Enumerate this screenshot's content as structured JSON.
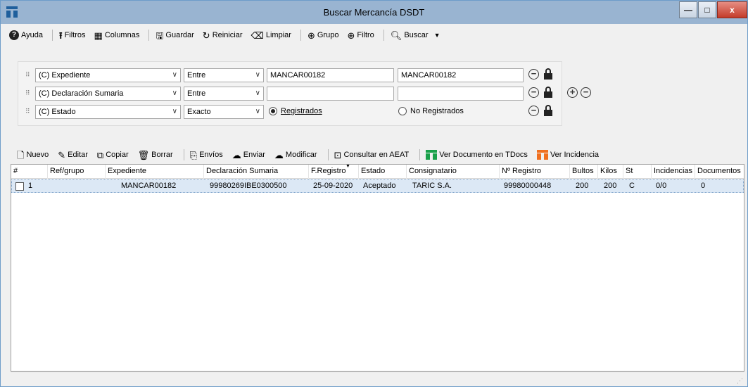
{
  "window": {
    "title": "Buscar Mercancía DSDT",
    "minimize": "—",
    "maximize": "□",
    "close": "x"
  },
  "menubar": {
    "ayuda": "Ayuda",
    "filtros": "Filtros",
    "columnas": "Columnas",
    "guardar": "Guardar",
    "reiniciar": "Reiniciar",
    "limpiar": "Limpiar",
    "grupo": "Grupo",
    "filtro": "Filtro",
    "buscar": "Buscar"
  },
  "filters": {
    "row1": {
      "field": "(C) Expediente",
      "operator": "Entre",
      "value_from": "MANCAR00182",
      "value_to": "MANCAR00182"
    },
    "row2": {
      "field": "(C) Declaración Sumaria",
      "operator": "Entre",
      "value_from": "",
      "value_to": ""
    },
    "row3": {
      "field": "(C) Estado",
      "operator": "Exacto",
      "option_registrados": "Registrados",
      "option_no_registrados": "No Registrados",
      "selected": "Registrados"
    }
  },
  "toolbar": {
    "nuevo": "Nuevo",
    "editar": "Editar",
    "copiar": "Copiar",
    "borrar": "Borrar",
    "envios": "Envíos",
    "enviar": "Enviar",
    "modificar": "Modificar",
    "consultar": "Consultar en AEAT",
    "ver_documento": "Ver Documento en TDocs",
    "ver_incidencia": "Ver Incidencia"
  },
  "grid": {
    "headers": {
      "num": "#",
      "ref": "Ref/grupo",
      "expediente": "Expediente",
      "declaracion": "Declaración Sumaria",
      "fregistro": "F.Registro",
      "estado": "Estado",
      "consignatario": "Consignatario",
      "nregistro": "Nº Registro",
      "bultos": "Bultos",
      "kilos": "Kilos",
      "st": "St",
      "incidencias": "Incidencias",
      "documentos": "Documentos"
    },
    "rows": [
      {
        "num": "1",
        "ref": "",
        "expediente": "MANCAR00182",
        "declaracion": "99980269IBE0300500",
        "fregistro": "25-09-2020",
        "estado": "Aceptado",
        "consignatario": "TARIC S.A.",
        "nregistro": "99980000448",
        "bultos": "200",
        "kilos": "200",
        "st": "C",
        "incidencias": "0/0",
        "documentos": "0"
      }
    ]
  },
  "colors": {
    "titlebar": "#99b4d1",
    "tdocs_green": "#1aa04a",
    "incidencia_orange": "#f07020",
    "selected_row": "#dce8f5"
  }
}
